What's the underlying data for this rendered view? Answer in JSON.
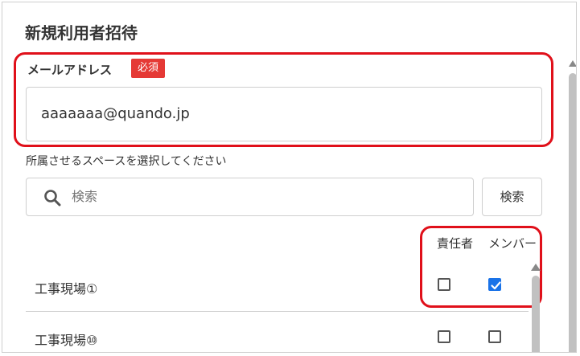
{
  "dialog": {
    "title": "新規利用者招待"
  },
  "email": {
    "label": "メールアドレス",
    "required_badge": "必須",
    "value": "aaaaaaa@quando.jp"
  },
  "space": {
    "label": "所属させるスペースを選択してください",
    "search_placeholder": "検索",
    "search_button": "検索",
    "columns": [
      "責任者",
      "メンバー"
    ],
    "rows": [
      {
        "name": "工事現場①",
        "owner": false,
        "member": true
      },
      {
        "name": "工事現場⑩",
        "owner": false,
        "member": false
      }
    ]
  },
  "colors": {
    "required": "#e53935",
    "highlight": "#e0101a",
    "checkbox_checked": "#1a73e8"
  },
  "icons": {
    "search": "search-icon",
    "check": "check-icon"
  }
}
